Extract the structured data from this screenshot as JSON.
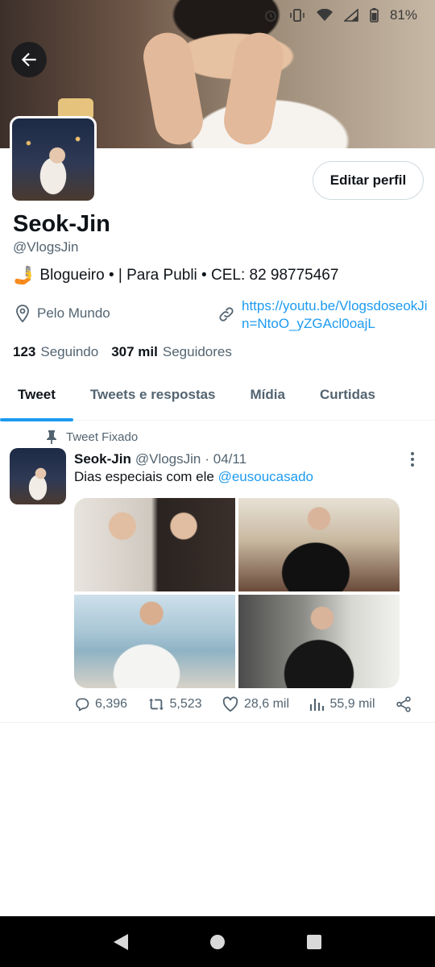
{
  "status_bar": {
    "battery": "81%"
  },
  "profile": {
    "name": "Seok-Jin",
    "handle": "@VlogsJin",
    "bio_emoji": "🤳",
    "bio": "Blogueiro • | Para Publi • CEL: 82 98775467",
    "location": "Pelo Mundo",
    "link": "https://youtu.be/VlogsdoseokJin=NtoO_yZGAcl0oajL",
    "following_count": "123",
    "following_label": "Seguindo",
    "followers_count": "307 mil",
    "followers_label": "Seguidores",
    "edit_button": "Editar perfil"
  },
  "tabs": [
    "Tweet",
    "Tweets e respostas",
    "Mídia",
    "Curtidas"
  ],
  "tweet": {
    "pinned_label": "Tweet Fixado",
    "author": "Seok-Jin",
    "handle": "@VlogsJin",
    "date_sep": "· 04/11",
    "text": "Dias especiais com ele",
    "mention": "@eusoucasado",
    "replies": "6,396",
    "retweets": "5,523",
    "likes": "28,6 mil",
    "views": "55,9 mil"
  },
  "icons": {
    "back": "arrow-left-icon",
    "location": "location-pin-icon",
    "link": "link-icon",
    "pin": "pin-icon",
    "more": "more-vertical-icon",
    "reply": "reply-icon",
    "retweet": "retweet-icon",
    "like": "heart-icon",
    "views": "views-icon",
    "share": "share-icon"
  },
  "colors": {
    "accent": "#1d9bf0",
    "secondary_text": "#536471",
    "primary_text": "#0f1419",
    "nav_bar": "#000000"
  }
}
